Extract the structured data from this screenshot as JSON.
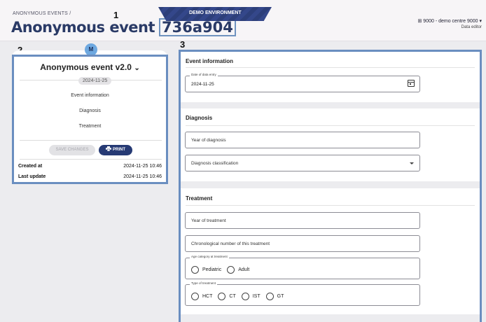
{
  "header": {
    "breadcrumb": "ANONYMOUS EVENTS /",
    "title": "Anonymous event",
    "event_id": "736a904",
    "env_banner": "DEMO ENVIRONMENT",
    "centre": "⊞ 9000 - demo centre 9000 ▾",
    "role": "Data editor"
  },
  "markers": [
    "1",
    "2",
    "3"
  ],
  "sidebar": {
    "avatar": "M",
    "version": "Anonymous event v2.0",
    "version_chevron": "⌄",
    "date_chip": "2024-11-25",
    "nav": [
      "Event information",
      "Diagnosis",
      "Treatment"
    ],
    "save_label": "SAVE CHANGES",
    "print_label": "PRINT",
    "created_label": "Created at",
    "created_value": "2024-11-25 10:46",
    "updated_label": "Last update",
    "updated_value": "2024-11-25 10:46"
  },
  "form": {
    "event_information": {
      "title": "Event information",
      "date_legend": "Date of data entry",
      "date_value": "2024-11-25"
    },
    "diagnosis": {
      "title": "Diagnosis",
      "year_placeholder": "Year of diagnosis",
      "classification_placeholder": "Diagnosis classification"
    },
    "treatment": {
      "title": "Treatment",
      "year_placeholder": "Year of treatment",
      "chrono_placeholder": "Chronological number of this treatment",
      "age_legend": "Age category at treatment",
      "age_options": [
        "Pediatric",
        "Adult"
      ],
      "type_legend": "Type of treatment",
      "type_options": [
        "HCT",
        "CT",
        "IST",
        "GT"
      ]
    }
  }
}
